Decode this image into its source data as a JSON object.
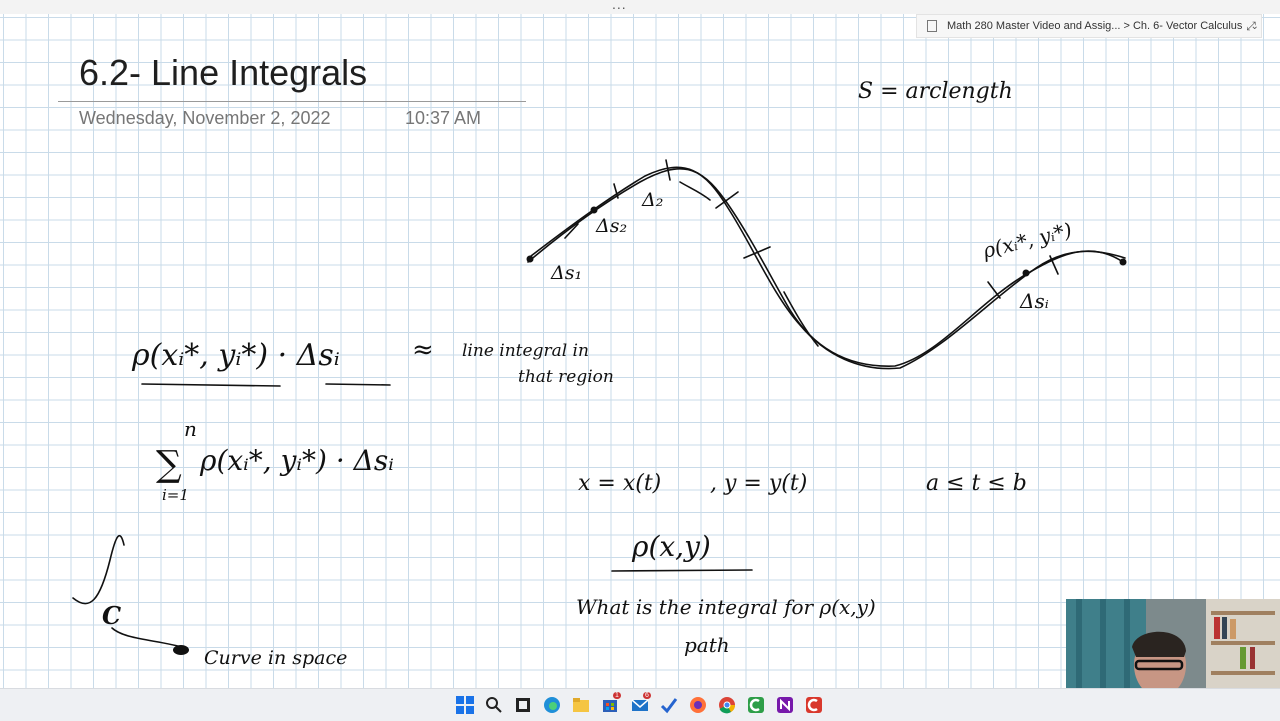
{
  "window": {
    "more_menu": "..."
  },
  "breadcrumb": {
    "text": "Math 280 Master Video and Assig... > Ch. 6- Vector Calculus",
    "icon": "notebook-icon"
  },
  "page": {
    "title": "6.2- Line Integrals",
    "date": "Wednesday, November 2, 2022",
    "time": "10:37 AM"
  },
  "handwriting": {
    "arclength": "S = arclength",
    "delta_s1": "Δs₁",
    "delta_s2": "Δs₂",
    "delta_2": "Δ₂",
    "delta_si": "Δsᵢ",
    "point_label": "ρ(xᵢ*, yᵢ*)",
    "product": "ρ(xᵢ*, yᵢ*) · Δsᵢ",
    "approx": "≈",
    "line_integral": "line integral in",
    "that_region": "that region",
    "sum_top": "n",
    "sum_symbol": "∑",
    "sum_body": "ρ(xᵢ*, yᵢ*) · Δsᵢ",
    "sum_bottom": "i=1",
    "param_x": "x = x(t)",
    "param_y": ", y = y(t)",
    "param_range": "a ≤ t ≤ b",
    "density": "ρ(x,y)",
    "question": "What is the integral for ρ(x,y)",
    "path": "path",
    "curve_label": "C",
    "curve_in_space": "Curve in space"
  },
  "taskbar": {
    "icons": [
      "windows-start-icon",
      "search-icon",
      "task-view-icon",
      "edge-icon",
      "file-explorer-icon",
      "store-icon",
      "mail-icon",
      "todo-icon",
      "firefox-icon",
      "chrome-icon",
      "camtasia-icon",
      "onenote-icon",
      "camtasia-recorder-icon"
    ],
    "badges": {
      "store": "1",
      "mail": "6"
    }
  },
  "colors": {
    "grid": "#c9dbe9",
    "ink": "#111111",
    "title": "#1f1f1f",
    "date": "#767676"
  }
}
